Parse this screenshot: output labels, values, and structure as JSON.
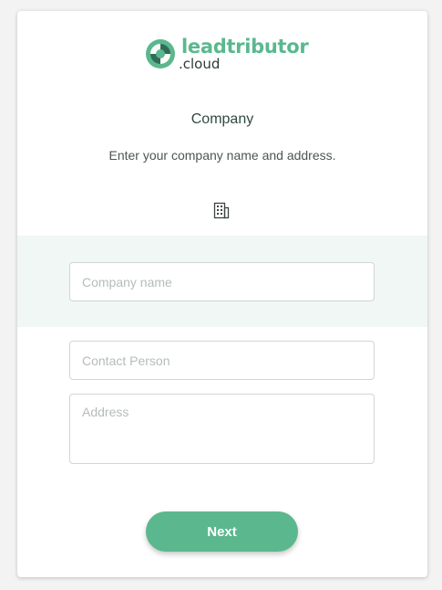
{
  "brand": {
    "name": "leadtributor",
    "suffix": ".cloud",
    "logo_icon": "swirl-logo-icon",
    "color": "#5bb88e"
  },
  "step": {
    "title": "Company",
    "description": "Enter your company name and address.",
    "icon": "building-icon"
  },
  "form": {
    "company_name_placeholder": "Company name",
    "contact_person_placeholder": "Contact Person",
    "address_placeholder": "Address"
  },
  "actions": {
    "next_label": "Next"
  }
}
